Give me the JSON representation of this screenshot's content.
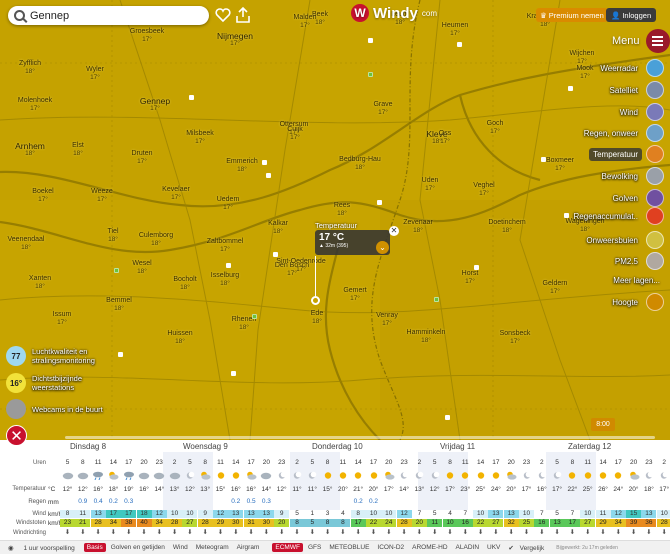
{
  "search": {
    "value": "Gennep"
  },
  "logo": {
    "text": "Windy",
    "suffix": "com"
  },
  "premium_label": "Premium nemen",
  "login_label": "Inloggen",
  "menu_label": "Menu",
  "layers": [
    {
      "label": "Weerradar",
      "color": "#4aa0d8",
      "active": false
    },
    {
      "label": "Satelliet",
      "color": "#7b8aa8",
      "active": false
    },
    {
      "label": "Wind",
      "color": "#7a7ab8",
      "active": false
    },
    {
      "label": "Regen, onweer",
      "color": "#6ea0c8",
      "active": false
    },
    {
      "label": "Temperatuur",
      "color": "#e08020",
      "active": true
    },
    {
      "label": "Bewolking",
      "color": "#9aa0a8",
      "active": false
    },
    {
      "label": "Golven",
      "color": "#7050a0",
      "active": false
    },
    {
      "label": "Regenaccumulat..",
      "color": "#e04020",
      "active": false
    },
    {
      "label": "Onweersbuien",
      "color": "#d0c040",
      "active": false
    },
    {
      "label": "PM2.5",
      "color": "#b0a8a0",
      "active": false
    },
    {
      "label": "Meer lagen...",
      "color": "",
      "active": false
    },
    {
      "label": "Hoogte",
      "color": "#d08a00",
      "active": false
    }
  ],
  "cities": [
    {
      "name": "Beek",
      "temp": "18°"
    },
    {
      "name": "Leuth",
      "temp": "18°"
    },
    {
      "name": "Kranenburg",
      "temp": "18°"
    },
    {
      "name": "Zyfflich",
      "temp": "18°"
    },
    {
      "name": "Wyler",
      "temp": "17°"
    },
    {
      "name": "Groesbeek",
      "temp": "17°"
    },
    {
      "name": "Nijmegen",
      "temp": "17°"
    },
    {
      "name": "Malden",
      "temp": "17°"
    },
    {
      "name": "Heumen",
      "temp": "17°"
    },
    {
      "name": "Wijchen",
      "temp": "17°"
    },
    {
      "name": "Mook",
      "temp": "17°"
    },
    {
      "name": "Molenhoek",
      "temp": "17°"
    },
    {
      "name": "Gennep",
      "temp": "17°"
    },
    {
      "name": "Milsbeek",
      "temp": "17°"
    },
    {
      "name": "Ottersum",
      "temp": "17°"
    },
    {
      "name": "Cuijk",
      "temp": "17°"
    },
    {
      "name": "Grave",
      "temp": "17°"
    },
    {
      "name": "Kleve",
      "temp": "18°"
    },
    {
      "name": "Goch",
      "temp": "17°"
    },
    {
      "name": "Boxmeer",
      "temp": "17°"
    },
    {
      "name": "Arnhem",
      "temp": "18°"
    },
    {
      "name": "Elst",
      "temp": "18°"
    },
    {
      "name": "Druten",
      "temp": "17°"
    },
    {
      "name": "Emmerich",
      "temp": "18°"
    },
    {
      "name": "Bedburg-Hau",
      "temp": "18°"
    },
    {
      "name": "Uden",
      "temp": "17°"
    },
    {
      "name": "Oss",
      "temp": "17°"
    },
    {
      "name": "Veghel",
      "temp": "17°"
    },
    {
      "name": "Boekel",
      "temp": "17°"
    },
    {
      "name": "Weeze",
      "temp": "17°"
    },
    {
      "name": "Kevelaer",
      "temp": "17°"
    },
    {
      "name": "Uedem",
      "temp": "17°"
    },
    {
      "name": "Kalkar",
      "temp": "18°"
    },
    {
      "name": "Rees",
      "temp": "18°"
    },
    {
      "name": "Zevenaar",
      "temp": "18°"
    },
    {
      "name": "Doetinchem",
      "temp": "18°"
    },
    {
      "name": "Wageningen",
      "temp": "18°"
    },
    {
      "name": "Veenendaal",
      "temp": "18°"
    },
    {
      "name": "Tiel",
      "temp": "18°"
    },
    {
      "name": "Culemborg",
      "temp": "18°"
    },
    {
      "name": "Zaltbommel",
      "temp": "17°"
    },
    {
      "name": "Den Bosch",
      "temp": "17°"
    },
    {
      "name": "Sint-Oedenrode",
      "temp": "17°"
    },
    {
      "name": "Gemert",
      "temp": "17°"
    },
    {
      "name": "Venray",
      "temp": "17°"
    },
    {
      "name": "Horst",
      "temp": "17°"
    },
    {
      "name": "Geldern",
      "temp": "17°"
    },
    {
      "name": "Xanten",
      "temp": "18°"
    },
    {
      "name": "Wesel",
      "temp": "18°"
    },
    {
      "name": "Bocholt",
      "temp": "18°"
    },
    {
      "name": "Isselburg",
      "temp": "18°"
    },
    {
      "name": "Ede",
      "temp": "18°"
    },
    {
      "name": "Rhenen",
      "temp": "18°"
    },
    {
      "name": "Hamminkeln",
      "temp": "18°"
    },
    {
      "name": "Sonsbeck",
      "temp": "17°"
    },
    {
      "name": "Issum",
      "temp": "17°"
    },
    {
      "name": "Bemmel",
      "temp": "18°"
    },
    {
      "name": "Huissen",
      "temp": "18°"
    }
  ],
  "popup": {
    "title": "Temperatuur",
    "value": "17 °C",
    "sub": "▲ 32m (395)"
  },
  "left_widgets": [
    {
      "badge": "77",
      "text": "Luchtkwaliteit en stralingsmonitoring",
      "color": "#9fd8f0"
    },
    {
      "badge": "16°",
      "text": "Dichtstbijzijnde weerstations",
      "color": "#f2e23a"
    },
    {
      "badge": "",
      "text": "Webcams in de buurt",
      "color": "#9a9a9a"
    }
  ],
  "time_bubble": "8:00",
  "forecast": {
    "days": [
      "Dinsdag 8",
      "Woensdag 9",
      "Donderdag 10",
      "Vrijdag 11",
      "Zaterdag 12"
    ],
    "row_labels": {
      "hours": "Uren",
      "temp": "Temperatuur",
      "rain": "Regen",
      "wind": "Wind",
      "gusts": "Windstoten",
      "dir": "Windrichting"
    },
    "units": {
      "temp": "°C",
      "rain": "mm",
      "wind": "km/h",
      "gusts": "km/h"
    },
    "hours": [
      "5",
      "8",
      "11",
      "14",
      "17",
      "20",
      "23",
      "2",
      "5",
      "8",
      "11",
      "14",
      "17",
      "20",
      "23",
      "2",
      "5",
      "8",
      "11",
      "14",
      "17",
      "20",
      "23",
      "2",
      "5",
      "8",
      "11",
      "14",
      "17",
      "20",
      "23",
      "2",
      "5",
      "8",
      "11",
      "14",
      "17",
      "20",
      "23",
      "2"
    ],
    "temps": [
      "12°",
      "12°",
      "16°",
      "18°",
      "19°",
      "16°",
      "14°",
      "13°",
      "12°",
      "13°",
      "15°",
      "16°",
      "16°",
      "14°",
      "12°",
      "11°",
      "11°",
      "15°",
      "20°",
      "21°",
      "20°",
      "17°",
      "14°",
      "13°",
      "12°",
      "17°",
      "23°",
      "25°",
      "24°",
      "20°",
      "17°",
      "16°",
      "17°",
      "22°",
      "25°",
      "26°",
      "24°",
      "20°",
      "18°",
      "17°"
    ],
    "rain": [
      "",
      "0.9",
      "0.4",
      "0.2",
      "0.3",
      "",
      "",
      "",
      "",
      "",
      "",
      "0.2",
      "0.5",
      "0.3",
      "",
      "",
      "",
      "",
      "",
      "0.2",
      "0.2",
      "",
      "",
      "",
      "",
      "",
      "",
      "",
      "",
      "",
      "",
      "",
      "",
      "",
      "",
      "",
      "",
      "",
      "",
      ""
    ],
    "wind": [
      "8",
      "11",
      "13",
      "17",
      "17",
      "18",
      "12",
      "10",
      "10",
      "9",
      "12",
      "13",
      "13",
      "13",
      "9",
      "5",
      "1",
      "3",
      "4",
      "8",
      "10",
      "10",
      "12",
      "7",
      "5",
      "4",
      "7",
      "10",
      "13",
      "13",
      "10",
      "7",
      "5",
      "7",
      "10",
      "11",
      "12",
      "15",
      "13",
      "10"
    ],
    "gusts": [
      "23",
      "21",
      "28",
      "34",
      "38",
      "40",
      "34",
      "28",
      "27",
      "28",
      "29",
      "30",
      "31",
      "30",
      "20",
      "8",
      "5",
      "8",
      "8",
      "17",
      "22",
      "24",
      "28",
      "20",
      "11",
      "10",
      "16",
      "22",
      "27",
      "32",
      "25",
      "16",
      "13",
      "17",
      "27",
      "29",
      "34",
      "39",
      "36",
      "28"
    ],
    "weather": [
      "cloudy",
      "cloudy",
      "rain",
      "partly",
      "rain",
      "cloudy",
      "cloudy",
      "cloudy",
      "night",
      "partly",
      "sun",
      "sun",
      "partly",
      "cloudy",
      "night",
      "night",
      "night",
      "sun",
      "sun",
      "sun",
      "sun",
      "partly",
      "night",
      "night",
      "night",
      "sun",
      "sun",
      "sun",
      "sun",
      "partly",
      "night",
      "night",
      "night",
      "sun",
      "sun",
      "sun",
      "sun",
      "partly",
      "night",
      "night"
    ]
  },
  "bottom": {
    "forecast_toggle": "1 uur voorspelling",
    "tabs": [
      "Basis",
      "Golven en getijden",
      "Wind",
      "Meteogram",
      "Airgram"
    ],
    "models": [
      "ECMWF",
      "GFS",
      "METEOBLUE",
      "ICON-D2",
      "AROME-HD",
      "ALADIN",
      "UKV"
    ],
    "compare": "Vergelijk",
    "updated": "Bijgewerkt: 2u 17m geleden"
  },
  "colors": {
    "map": "#c6a300",
    "brand": "#c8102e",
    "premium": "#d98b00"
  }
}
